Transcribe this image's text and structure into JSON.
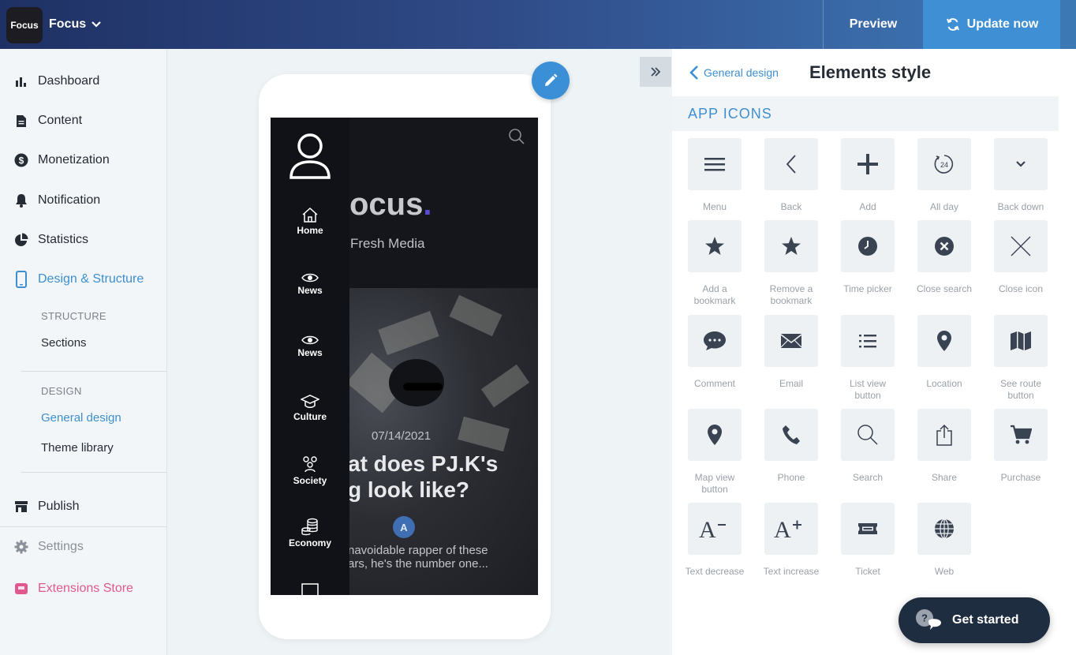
{
  "header": {
    "logo_text": "Focus",
    "app_name": "Focus",
    "preview_label": "Preview",
    "update_label": "Update now"
  },
  "sidebar": {
    "items": [
      {
        "label": "Dashboard",
        "icon": "bar-chart-icon"
      },
      {
        "label": "Content",
        "icon": "document-icon"
      },
      {
        "label": "Monetization",
        "icon": "dollar-icon"
      },
      {
        "label": "Notification",
        "icon": "bell-icon"
      },
      {
        "label": "Statistics",
        "icon": "pie-chart-icon"
      },
      {
        "label": "Design & Structure",
        "icon": "phone-icon"
      }
    ],
    "structure_header": "STRUCTURE",
    "sections_label": "Sections",
    "design_header": "DESIGN",
    "general_design_label": "General design",
    "theme_library_label": "Theme library",
    "publish_label": "Publish",
    "settings_label": "Settings",
    "extensions_label": "Extensions Store"
  },
  "preview": {
    "brand_fragment": "ocus",
    "tagline_fragment": "Fresh Media",
    "date": "07/14/2021",
    "headline_line1": "at does PJ.K's",
    "headline_line2": "g look like?",
    "avatar_letter": "A",
    "excerpt_line1": "navoidable rapper of these",
    "excerpt_line2": "ars, he's the number one...",
    "menu": [
      {
        "label": "Home",
        "icon": "home-icon"
      },
      {
        "label": "News",
        "icon": "eye-icon"
      },
      {
        "label": "News",
        "icon": "eye-icon"
      },
      {
        "label": "Culture",
        "icon": "graduation-cap-icon"
      },
      {
        "label": "Society",
        "icon": "people-icon"
      },
      {
        "label": "Economy",
        "icon": "coins-icon"
      }
    ]
  },
  "panel": {
    "back_label": "General design",
    "title": "Elements style",
    "section_title": "APP ICONS",
    "icons": [
      {
        "label": "Menu",
        "icon": "menu-icon"
      },
      {
        "label": "Back",
        "icon": "back-icon"
      },
      {
        "label": "Add",
        "icon": "add-icon"
      },
      {
        "label": "All day",
        "icon": "all-day-icon"
      },
      {
        "label": "Back down",
        "icon": "chevron-down-icon"
      },
      {
        "label": "Add a bookmark",
        "icon": "star-icon"
      },
      {
        "label": "Remove a bookmark",
        "icon": "star-icon"
      },
      {
        "label": "Time picker",
        "icon": "clock-icon"
      },
      {
        "label": "Close search",
        "icon": "close-circle-icon"
      },
      {
        "label": "Close icon",
        "icon": "close-icon"
      },
      {
        "label": "Comment",
        "icon": "comment-icon"
      },
      {
        "label": "Email",
        "icon": "email-icon"
      },
      {
        "label": "List view button",
        "icon": "list-icon"
      },
      {
        "label": "Location",
        "icon": "location-icon"
      },
      {
        "label": "See route button",
        "icon": "map-icon"
      },
      {
        "label": "Map view button",
        "icon": "map-pin-icon"
      },
      {
        "label": "Phone",
        "icon": "phone-icon"
      },
      {
        "label": "Search",
        "icon": "search-icon"
      },
      {
        "label": "Share",
        "icon": "share-icon"
      },
      {
        "label": "Purchase",
        "icon": "cart-icon"
      },
      {
        "label": "Text decrease",
        "icon": "text-decrease-icon"
      },
      {
        "label": "Text increase",
        "icon": "text-increase-icon"
      },
      {
        "label": "Ticket",
        "icon": "ticket-icon"
      },
      {
        "label": "Web",
        "icon": "globe-icon"
      }
    ]
  },
  "get_started_label": "Get started",
  "colors": {
    "accent": "#3d8fd1",
    "topbar_dark": "#1f3164",
    "update_button": "#3e8fd3",
    "icon_dark": "#3a4352"
  }
}
